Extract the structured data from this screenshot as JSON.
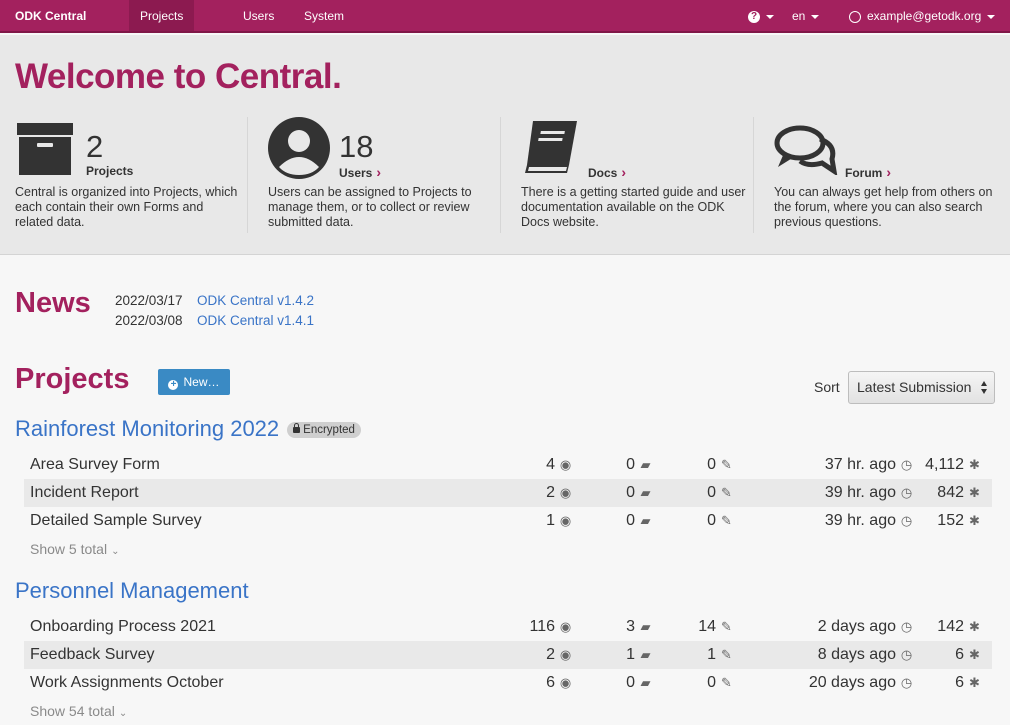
{
  "navbar": {
    "brand": "ODK Central",
    "items": [
      "Projects",
      "Users",
      "System"
    ],
    "help_icon": "?",
    "lang": "en",
    "user": "example@getodk.org"
  },
  "hero": {
    "welcome": "Welcome to Central.",
    "blocks": [
      {
        "icon": "archive-box-icon",
        "count": "2",
        "title": "Projects",
        "desc": "Central is organized into Projects, which each contain their own Forms and related data."
      },
      {
        "icon": "user-circle-icon",
        "count": "18",
        "title": "Users",
        "desc": "Users can be assigned to Projects to manage them, or to collect or review submitted data."
      },
      {
        "icon": "book-icon",
        "count": "",
        "title": "Docs",
        "desc": "There is a getting started guide and user documentation available on the ODK Docs website."
      },
      {
        "icon": "chat-bubbles-icon",
        "count": "",
        "title": "Forum",
        "desc": "You can always get help from others on the forum, where you can also search previous questions."
      }
    ]
  },
  "news": {
    "heading": "News",
    "items": [
      {
        "date": "2022/03/17",
        "link": "ODK Central v1.4.2"
      },
      {
        "date": "2022/03/08",
        "link": "ODK Central v1.4.1"
      }
    ]
  },
  "projects": {
    "heading": "Projects",
    "new_label": "New…",
    "sort_label": "Sort",
    "sort_value": "Latest Submission",
    "groups": [
      {
        "name": "Rainforest Monitoring 2022",
        "badge": "Encrypted",
        "forms": [
          {
            "name": "Area Survey Form",
            "received": "4",
            "comments": "0",
            "edited": "0",
            "latest": "37 hr. ago",
            "total": "4,112"
          },
          {
            "name": "Incident Report",
            "received": "2",
            "comments": "0",
            "edited": "0",
            "latest": "39 hr. ago",
            "total": "842"
          },
          {
            "name": "Detailed Sample Survey",
            "received": "1",
            "comments": "0",
            "edited": "0",
            "latest": "39 hr. ago",
            "total": "152"
          }
        ],
        "show_total": "Show 5 total"
      },
      {
        "name": "Personnel Management",
        "badge": "",
        "forms": [
          {
            "name": "Onboarding Process 2021",
            "received": "116",
            "comments": "3",
            "edited": "14",
            "latest": "2 days ago",
            "total": "142"
          },
          {
            "name": "Feedback Survey",
            "received": "2",
            "comments": "1",
            "edited": "1",
            "latest": "8 days ago",
            "total": "6"
          },
          {
            "name": "Work Assignments October",
            "received": "6",
            "comments": "0",
            "edited": "0",
            "latest": "20 days ago",
            "total": "6"
          }
        ],
        "show_total": "Show 54 total"
      }
    ]
  },
  "colors": {
    "brand": "#a3215e",
    "link": "#3a74c7",
    "button": "#3a8ac4"
  }
}
